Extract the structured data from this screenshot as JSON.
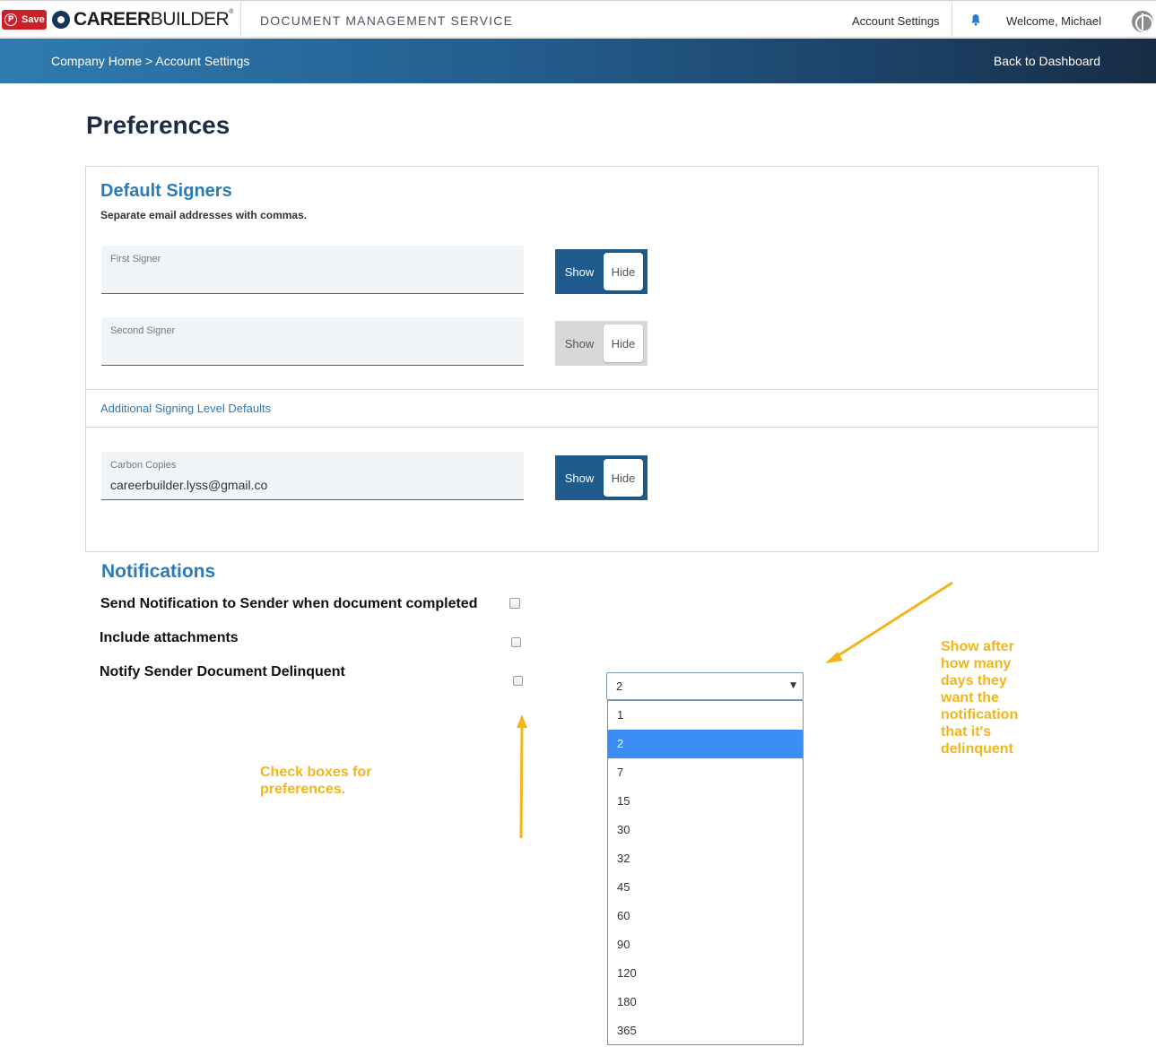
{
  "topbar": {
    "pin_save": "Save",
    "logo_bold": "CAREER",
    "logo_light": "BUILDER",
    "logo_mark": "®",
    "service_title": "DOCUMENT MANAGEMENT SERVICE",
    "account_settings": "Account Settings",
    "welcome": "Welcome, Michael"
  },
  "breadcrumb": {
    "home": "Company Home",
    "separator": ">",
    "current": "Account Settings",
    "back": "Back to Dashboard"
  },
  "page_title": "Preferences",
  "default_signers": {
    "title": "Default Signers",
    "subtitle": "Separate email addresses with commas.",
    "fields": [
      {
        "label": "First Signer",
        "value": "",
        "toggle_show": "Show",
        "toggle_hide": "Hide",
        "toggle_state": "show"
      },
      {
        "label": "Second Signer",
        "value": "",
        "toggle_show": "Show",
        "toggle_hide": "Hide",
        "toggle_state": "hide"
      }
    ],
    "additional_link": "Additional Signing Level Defaults",
    "carbon_copies": {
      "label": "Carbon Copies",
      "value": "careerbuilder.lyss@gmail.co",
      "toggle_show": "Show",
      "toggle_hide": "Hide",
      "toggle_state": "show"
    }
  },
  "notifications": {
    "title": "Notifications",
    "items": [
      {
        "label": "Send Notification to Sender when document completed",
        "checked": false
      },
      {
        "label": "Include attachments",
        "checked": false
      },
      {
        "label": "Notify Sender Document Delinquent",
        "checked": false
      }
    ],
    "days_select": {
      "selected": "2",
      "options": [
        "1",
        "2",
        "7",
        "15",
        "30",
        "32",
        "45",
        "60",
        "90",
        "120",
        "180",
        "365"
      ]
    }
  },
  "annotations": {
    "checkbox_note": [
      "Check boxes for",
      "preferences."
    ],
    "select_note": [
      "Show after",
      "how many",
      "days they",
      "want the",
      "notification",
      "that it's",
      "delinquent"
    ]
  },
  "colors": {
    "accent_blue": "#2c7ab6",
    "toggle_on": "#1f5a8c",
    "selected_option": "#3a8ef6",
    "annotation": "#f2b51d",
    "pinterest_red": "#cb2027"
  },
  "icons": [
    "pinterest-icon",
    "careerbuilder-logo-icon",
    "bell-icon",
    "globe-icon",
    "dropdown-caret-icon"
  ]
}
